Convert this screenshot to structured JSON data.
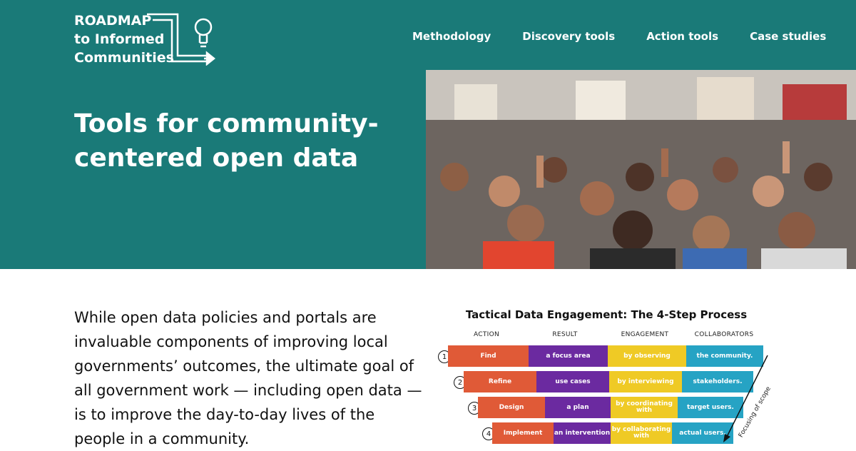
{
  "logo": {
    "line1": "ROADMAP",
    "line2": "to Informed",
    "line3": "Communities"
  },
  "nav": [
    "Methodology",
    "Discovery tools",
    "Action tools",
    "Case studies"
  ],
  "hero": {
    "title": "Tools for community-centered open data"
  },
  "intro": "While open data policies and portals are invaluable components of improving local governments’ outcomes, the ultimate goal of all government work — including open data — is to improve the day-to-day lives of the people in a community.",
  "diagram": {
    "title": "Tactical Data Engagement: The 4-Step Process",
    "headers": [
      "ACTION",
      "RESULT",
      "ENGAGEMENT",
      "COLLABORATORS"
    ],
    "rows": [
      {
        "num": "1",
        "action": "Find",
        "result": "a focus area",
        "engagement": "by observing",
        "collaborators": "the community."
      },
      {
        "num": "2",
        "action": "Refine",
        "result": "use cases",
        "engagement": "by interviewing",
        "collaborators": "stakeholders."
      },
      {
        "num": "3",
        "action": "Design",
        "result": "a plan",
        "engagement": "by coordinating with",
        "collaborators": "target users."
      },
      {
        "num": "4",
        "action": "Implement",
        "result": "an intervention",
        "engagement": "by collaborating with",
        "collaborators": "actual users."
      }
    ],
    "scope_label": "Focusing of scope"
  },
  "colors": {
    "teal": "#1a7a78",
    "orange": "#e05a37",
    "purple": "#6b2aa0",
    "yellow": "#efca25",
    "blue": "#26a3c4"
  }
}
